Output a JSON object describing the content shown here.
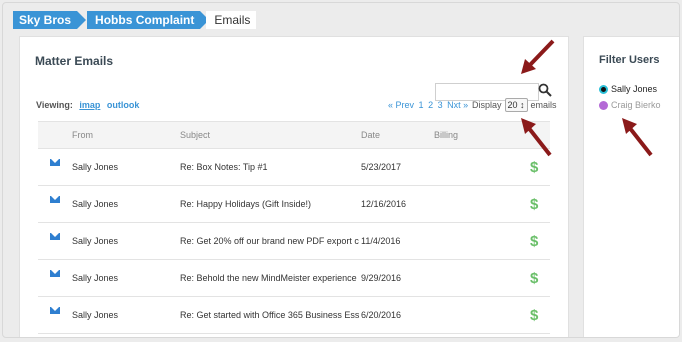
{
  "breadcrumb": [
    "Sky Bros",
    "Hobbs Complaint",
    "Emails"
  ],
  "panel": {
    "title": "Matter Emails",
    "search_placeholder": "",
    "viewing_label": "Viewing:",
    "views": [
      "imap",
      "outlook"
    ],
    "pager": {
      "prev": "« Prev",
      "pages": [
        "1",
        "2",
        "3"
      ],
      "next": "Nxt »"
    },
    "display_label": "Display",
    "display_value": "20 ↕",
    "display_suffix": "emails"
  },
  "table": {
    "headers": [
      "From",
      "Subject",
      "Date",
      "Billing"
    ],
    "rows": [
      {
        "from": "Sally Jones",
        "subject": "Re: Box Notes: Tip #1",
        "date": "5/23/2017",
        "billing": "$"
      },
      {
        "from": "Sally Jones",
        "subject": "Re: Happy Holidays (Gift Inside!)",
        "date": "12/16/2016",
        "billing": "$"
      },
      {
        "from": "Sally Jones",
        "subject": "Re: Get 20% off our brand new PDF export c",
        "date": "11/4/2016",
        "billing": "$"
      },
      {
        "from": "Sally Jones",
        "subject": "Re: Behold the new MindMeister experience",
        "date": "9/29/2016",
        "billing": "$"
      },
      {
        "from": "Sally Jones",
        "subject": "Re: Get started with Office 365 Business Ess",
        "date": "6/20/2016",
        "billing": "$"
      }
    ]
  },
  "filter": {
    "title": "Filter Users",
    "users": [
      {
        "name": "Sally Jones",
        "color": "#111111"
      },
      {
        "name": "Craig Bierko",
        "color": "#b46ad6"
      }
    ]
  },
  "colors": {
    "accent": "#3a94d6",
    "annotation_arrow": "#8b1a1a",
    "billing": "#6abf69"
  }
}
